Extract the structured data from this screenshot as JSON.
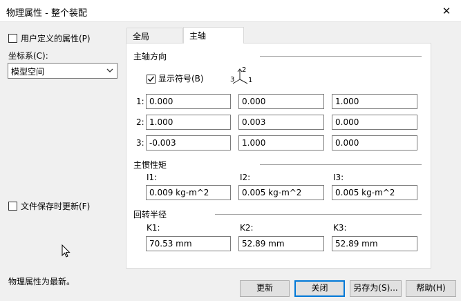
{
  "window": {
    "title": "物理属性 - 整个装配",
    "close_symbol": "✕"
  },
  "left": {
    "user_defined_label": "用户定义的属性(P)",
    "coord_label": "坐标系(C):",
    "coord_value": "模型空间",
    "auto_update_label": "文件保存时更新(F)"
  },
  "tabs": [
    {
      "label": "全局"
    },
    {
      "label": "主轴"
    }
  ],
  "principal_axes": {
    "section_title": "主轴方向",
    "show_symbol_label": "显示符号(B)",
    "show_symbol_checked": true,
    "triad": {
      "a": "2",
      "b": "3",
      "c": "1"
    },
    "rows": [
      {
        "label": "1:",
        "values": [
          "0.000",
          "0.000",
          "1.000"
        ]
      },
      {
        "label": "2:",
        "values": [
          "1.000",
          "0.003",
          "0.000"
        ]
      },
      {
        "label": "3:",
        "values": [
          "-0.003",
          "1.000",
          "0.000"
        ]
      }
    ]
  },
  "inertia": {
    "section_title": "主惯性矩",
    "items": [
      {
        "label": "I1:",
        "value": "0.009 kg-m^2"
      },
      {
        "label": "I2:",
        "value": "0.005 kg-m^2"
      },
      {
        "label": "I3:",
        "value": "0.005 kg-m^2"
      }
    ]
  },
  "gyration": {
    "section_title": "回转半径",
    "items": [
      {
        "label": "K1:",
        "value": "70.53 mm"
      },
      {
        "label": "K2:",
        "value": "52.89 mm"
      },
      {
        "label": "K3:",
        "value": "52.89 mm"
      }
    ]
  },
  "status": "物理属性为最新。",
  "buttons": {
    "update": "更新",
    "close": "关闭",
    "save_as": "另存为(S)...",
    "help": "帮助(H)"
  }
}
